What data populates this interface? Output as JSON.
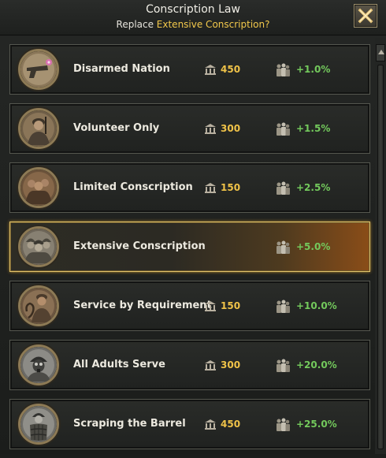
{
  "window": {
    "title": "Conscription Law",
    "subtitle_prefix": "Replace ",
    "subtitle_highlight": "Extensive Conscription?"
  },
  "colors": {
    "cost": "#efc248",
    "factor": "#73c95c",
    "highlight": "#f2c84b",
    "selected_border": "#e2c36a"
  },
  "laws": [
    {
      "name": "Disarmed Nation",
      "cost": "450",
      "factor": "+1.0%",
      "icon": "pistol-with-flower-icon",
      "selected": false
    },
    {
      "name": "Volunteer Only",
      "cost": "300",
      "factor": "+1.5%",
      "icon": "volunteer-soldier-icon",
      "selected": false
    },
    {
      "name": "Limited Conscription",
      "cost": "150",
      "factor": "+2.5%",
      "icon": "soldier-group-icon",
      "selected": false
    },
    {
      "name": "Extensive Conscription",
      "cost": "",
      "factor": "+5.0%",
      "icon": "helmeted-soldiers-icon",
      "selected": true
    },
    {
      "name": "Service by Requirement",
      "cost": "150",
      "factor": "+10.0%",
      "icon": "soldier-with-rope-icon",
      "selected": false
    },
    {
      "name": "All Adults Serve",
      "cost": "300",
      "factor": "+20.0%",
      "icon": "gas-mask-soldier-icon",
      "selected": false
    },
    {
      "name": "Scraping the Barrel",
      "cost": "450",
      "factor": "+25.0%",
      "icon": "soldier-in-barrel-icon",
      "selected": false
    }
  ]
}
